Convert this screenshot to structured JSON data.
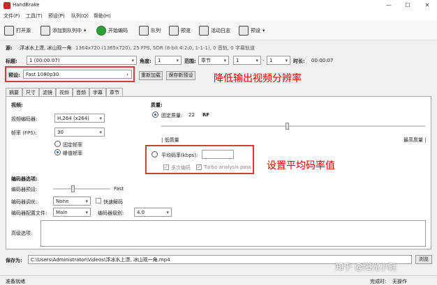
{
  "window": {
    "title": "HandBrake",
    "min": "—",
    "max": "☐",
    "close": "✕"
  },
  "menu": [
    "文件(F)",
    "工具(T)",
    "预设(P)",
    "队列(Q)",
    "帮助(H)"
  ],
  "toolbar": {
    "open_source": "打开源",
    "add_to_queue": "添加到队列中",
    "start_encode": "开始编码",
    "queue": "队列",
    "preview": "预览",
    "activity_log": "活动日志",
    "presets": "预设"
  },
  "source": {
    "label": "源:",
    "value": "浮冰水上漂, 冰山观一角",
    "info": "1364x720 (1365x720), 25 FPS, SDR (8-bit 4:2:0, 1-1-1), 0 音轨, 0 字幕轨道"
  },
  "title_row": {
    "title_label": "标题:",
    "title_value": "1 (00:00:07)",
    "angle_label": "角度:",
    "angle_value": "1",
    "range_label": "范围:",
    "range_value": "章节",
    "from": "1",
    "dash": "-",
    "to": "1",
    "duration_label": "时长:",
    "duration_value": "00:00:07"
  },
  "preset_row": {
    "label": "预设:",
    "value": "Fast 1080p30",
    "reload": "重新加载",
    "save_new": "保存新预设"
  },
  "annotations": {
    "resolution": "降低输出视频分辨率",
    "bitrate": "设置平均码率值"
  },
  "tabs": [
    "摘要",
    "尺寸",
    "滤镜",
    "视频",
    "音频",
    "字幕",
    "章节"
  ],
  "active_tab": 3,
  "video": {
    "section": "视频:",
    "encoder_label": "视频编码器:",
    "encoder_value": "H.264 (x264)",
    "fps_label": "帧率 (FPS):",
    "fps_value": "30",
    "const_fr": "固定帧率",
    "peak_fr": "峰值帧率"
  },
  "quality": {
    "section": "质量:",
    "cq_label": "固定质量:",
    "cq_value": "22",
    "rf": "RF",
    "low": "| 低质量",
    "high": "最高质量 |",
    "slider_fraction": 0.48,
    "abr_label": "平均码率(kbps):",
    "abr_value": "",
    "multipass": "多次编码",
    "turbo": "Turbo analysis pass"
  },
  "encoder_opts": {
    "section": "编码器选项:",
    "preset_label": "编码器预设:",
    "preset_text": "Fast",
    "preset_fraction": 0.35,
    "tune_label": "编码器调优:",
    "tune_value": "None",
    "fast_decode": "快速解码",
    "profile_label": "编码器配置文件:",
    "profile_value": "Main",
    "level_label": "编码器级别:",
    "level_value": "4.0",
    "advanced_label": "高级选项:"
  },
  "save": {
    "label": "保存为:",
    "path": "C:\\Users\\Administrator\\Videos\\浮冰水上漂, 冰山观一角.mp4",
    "browse": "浏览"
  },
  "status": {
    "left": "准备就绪",
    "right": "完成时:",
    "right_value": "无操作"
  },
  "watermark": "知乎 @阳光小鲑"
}
